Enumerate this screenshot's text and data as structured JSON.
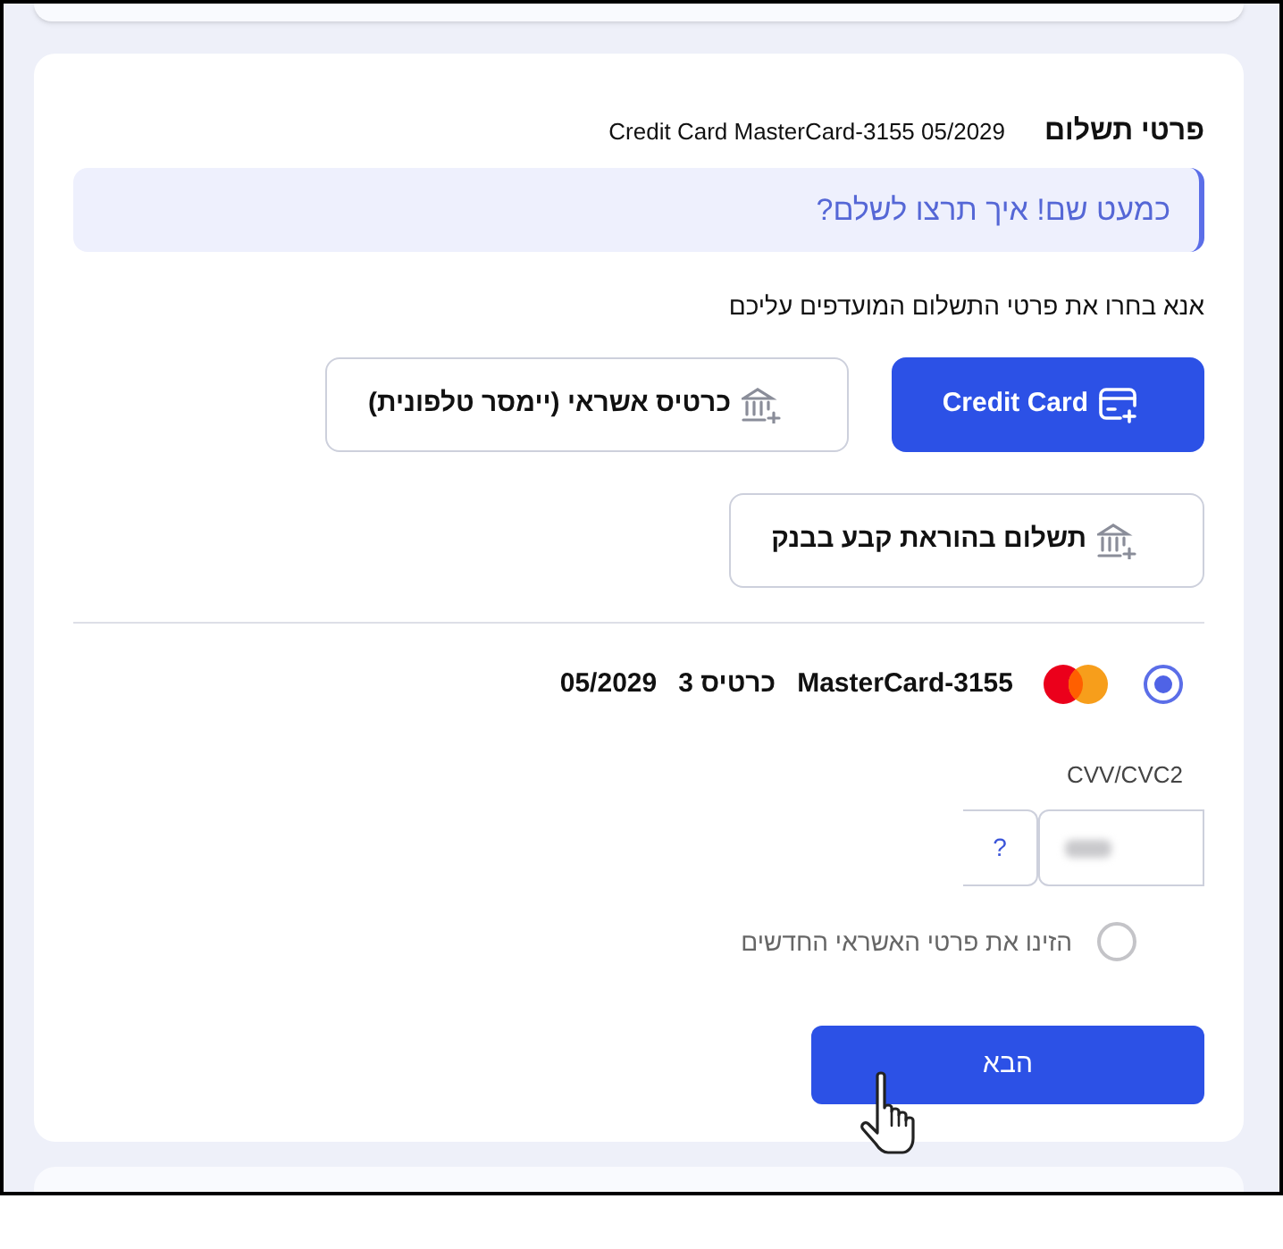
{
  "header": {
    "title": "פרטי תשלום",
    "summary": "Credit Card MasterCard-3155 05/2029"
  },
  "banner": {
    "text": "כמעט שם! איך תרצו לשלם?"
  },
  "instruction": "אנא בחרו את פרטי התשלום המועדפים עליכם",
  "payment_methods": [
    {
      "label": "Credit Card",
      "selected": true,
      "kind": "card"
    },
    {
      "label": "כרטיס אשראי (יימסר טלפונית)",
      "selected": false,
      "kind": "bank"
    },
    {
      "label": "תשלום בהוראת קבע בבנק",
      "selected": false,
      "kind": "bank"
    }
  ],
  "saved_cards": [
    {
      "number": "MasterCard-3155",
      "card_label": "כרטיס 3",
      "expiry": "05/2029",
      "selected": true
    }
  ],
  "cvv": {
    "label": "CVV/CVC2",
    "help": "?"
  },
  "new_card_option": {
    "label": "הזינו את פרטי האשראי החדשים",
    "selected": false
  },
  "next_button": {
    "label": "הבא"
  }
}
